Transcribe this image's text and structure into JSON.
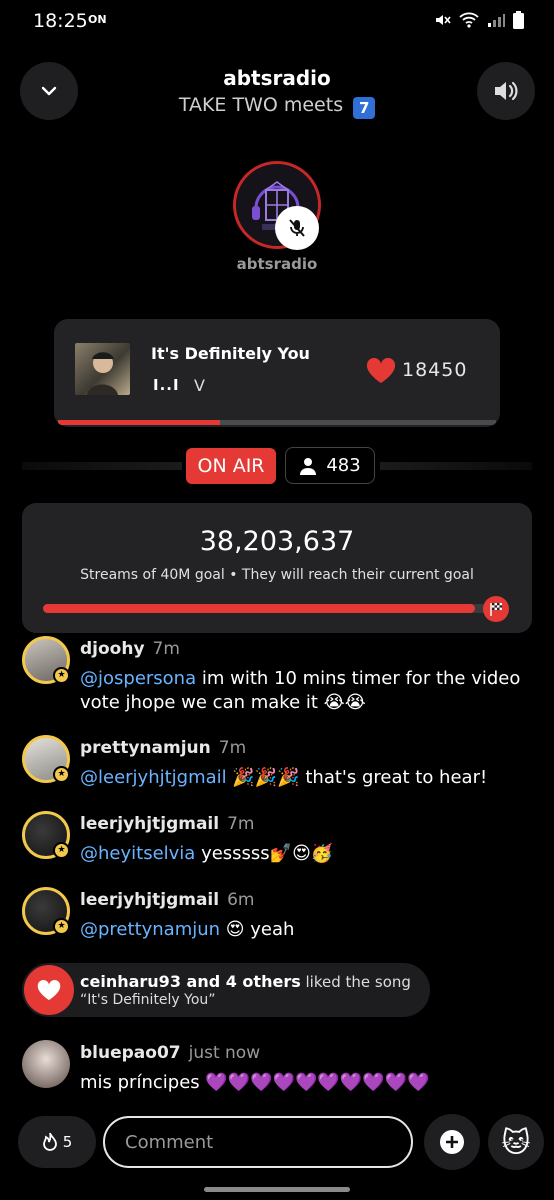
{
  "status_bar": {
    "time": "18:25",
    "carrier_badge": "ON"
  },
  "header": {
    "title": "abtsradio",
    "subtitle": "TAKE TWO meets",
    "subtitle_badge": "7"
  },
  "host": {
    "name": "abtsradio"
  },
  "now_playing": {
    "title": "It's Definitely You",
    "eq_glyph": "I..I",
    "artist": "V",
    "likes": "18450",
    "progress": 0.37
  },
  "live": {
    "status": "ON AIR",
    "listeners": "483"
  },
  "goal": {
    "count": "38,203,637",
    "caption": "Streams of 40M goal • They will reach their current goal",
    "progress": 0.955
  },
  "comments": [
    {
      "user": "djoohy",
      "time": "7m",
      "mention": "@jospersona",
      "text": " im with 10 mins timer for the video vote jhope we can make it 😭😭"
    },
    {
      "user": "prettynamjun",
      "time": "7m",
      "mention": "@leerjyhjtjgmail",
      "text": " 🎉🎉🎉 that's great to hear!"
    },
    {
      "user": "leerjyhjtjgmail",
      "time": "7m",
      "mention": "@heyitselvia",
      "text": " yesssss💅😍🥳"
    },
    {
      "user": "leerjyhjtjgmail",
      "time": "6m",
      "mention": "@prettynamjun",
      "text": " 😍 yeah"
    },
    {
      "user": "bluepao07",
      "time": "just now",
      "mention": "",
      "text": "mis príncipes 💜💜💜💜💜💜💜💜💜💜"
    }
  ],
  "like_banner": {
    "who": "ceinharu93 and 4 others",
    "action": " liked the song",
    "song": "“It's Definitely You”"
  },
  "bottom": {
    "fire_count": "5",
    "comment_placeholder": "Comment"
  },
  "colors": {
    "accent": "#e53935",
    "mention": "#6ab4ff",
    "badge": "#f2c94c"
  }
}
